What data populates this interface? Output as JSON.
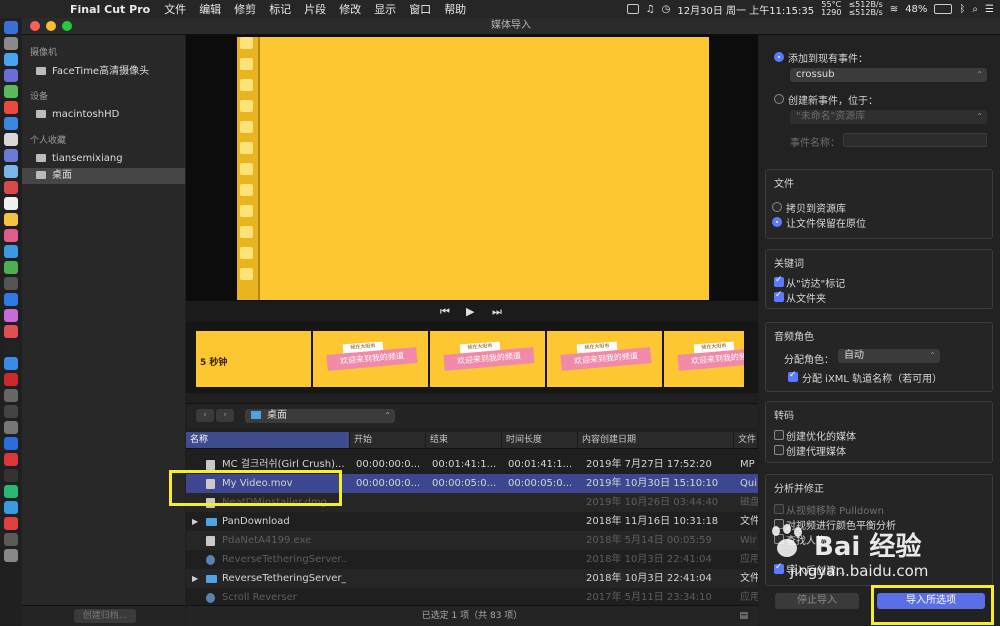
{
  "menubar": {
    "app_name": "Final Cut Pro",
    "items": [
      "文件",
      "编辑",
      "修剪",
      "标记",
      "片段",
      "修改",
      "显示",
      "窗口",
      "帮助"
    ],
    "temp": "55°C",
    "rpm": "1290",
    "net_up": "≤512B/s",
    "net_down": "≤512B/s",
    "datetime": "12月30日 周一 上午11:15:35",
    "battery": "48%"
  },
  "window": {
    "title": "媒体导入"
  },
  "sidebar": {
    "sections": [
      {
        "label": "摄像机",
        "items": [
          "FaceTime高清摄像头"
        ]
      },
      {
        "label": "设备",
        "items": [
          "macintoshHD"
        ]
      },
      {
        "label": "个人收藏",
        "items": [
          "tiansemixiang",
          "桌面"
        ]
      }
    ],
    "create_archive": "创建归档..."
  },
  "filmstrip": {
    "duration": "5 秒钟",
    "caption": "欢迎来到我的频道",
    "tag": "我在大阳市"
  },
  "browser": {
    "path": "桌面"
  },
  "table": {
    "headers": [
      "名称",
      "开始",
      "结束",
      "时间长度",
      "内容创建日期",
      "文件"
    ],
    "rows": [
      {
        "name": "MC 걸크러쉬(Girl Crush)...",
        "start": "00:00:00:0...",
        "end": "00:01:41:1...",
        "duration": "00:01:41:1...",
        "date": "2019年 7月27日 17:52:20",
        "type": "MP"
      },
      {
        "name": "My Video.mov",
        "start": "00:00:00:0...",
        "end": "00:00:05:0...",
        "duration": "00:00:05:0...",
        "date": "2019年 10月30日 15:10:10",
        "type": "Qui"
      },
      {
        "name": "NeatDMinstaller.dmg",
        "start": "",
        "end": "",
        "duration": "",
        "date": "2019年 10月26日 03:44:40",
        "type": "磁盘"
      },
      {
        "name": "PanDownload",
        "start": "",
        "end": "",
        "duration": "",
        "date": "2018年 11月16日 10:31:18",
        "type": "文件"
      },
      {
        "name": "PdaNetA4199.exe",
        "start": "",
        "end": "",
        "duration": "",
        "date": "2018年 5月14日 00:05:59",
        "type": "Wir"
      },
      {
        "name": "ReverseTetheringServer...",
        "start": "",
        "end": "",
        "duration": "",
        "date": "2018年 10月3日 22:41:04",
        "type": "应用"
      },
      {
        "name": "ReverseTetheringServer_...",
        "start": "",
        "end": "",
        "duration": "",
        "date": "2018年 10月3日 22:41:04",
        "type": "文件"
      },
      {
        "name": "Scroll Reverser",
        "start": "",
        "end": "",
        "duration": "",
        "date": "2017年 5月11日 23:34:10",
        "type": "应用"
      }
    ]
  },
  "status": "已选定 1 项（共 83 项）",
  "options": {
    "add_existing": "添加到现有事件：",
    "existing_event": "crossub",
    "create_new": "创建新事件，位于：",
    "library": "\"未命名\"资源库",
    "event_name_label": "事件名称：",
    "files_title": "文件",
    "copy_to_library": "拷贝到资源库",
    "leave_in_place": "让文件保留在原位",
    "keywords_title": "关键词",
    "from_finder_tags": "从\"访达\"标记",
    "from_folders": "从文件夹",
    "audio_title": "音频角色",
    "assign_role_label": "分配角色：",
    "assign_role_value": "自动",
    "ixml": "分配 iXML 轨道名称（若可用）",
    "transcode_title": "转码",
    "optimized": "创建优化的媒体",
    "proxy": "创建代理媒体",
    "analyze_title": "分析并修正",
    "pulldown": "从视频移除 Pulldown",
    "color_balance": "对视频进行颜色平衡分析",
    "find_people": "查找人物",
    "after_import": "导入后创建...",
    "stop_import": "停止导入",
    "import_selected": "导入所选项"
  },
  "watermark": {
    "brand": "Bai 经验",
    "url": "jingyan.baidu.com"
  },
  "colors": {
    "accent": "#5a7bff",
    "highlight": "#f7ef26",
    "video_bg": "#fcc731"
  }
}
